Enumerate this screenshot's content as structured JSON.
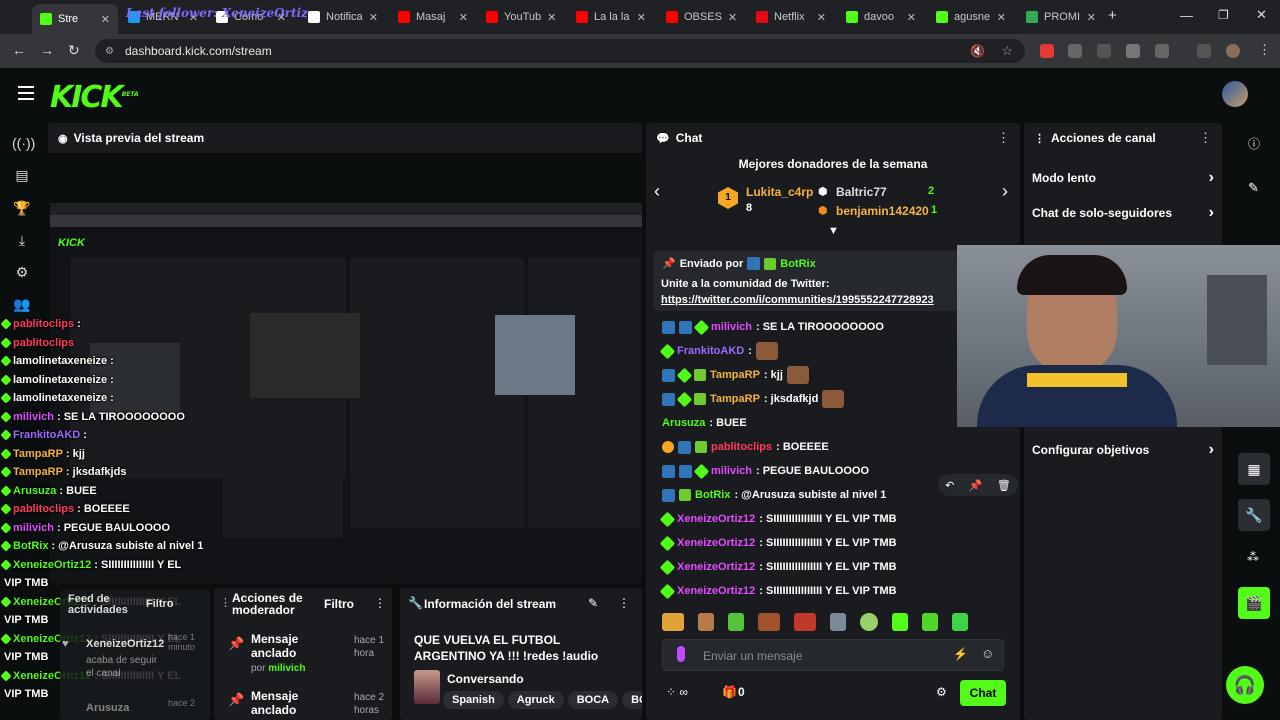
{
  "browser": {
    "tabs": [
      {
        "label": "Stre",
        "active": true,
        "color": "#53fc18"
      },
      {
        "label": "MERN",
        "color": "#1d9bf0"
      },
      {
        "label": "Como",
        "color": "#ffffff"
      },
      {
        "label": "Notifica",
        "color": "#ffffff"
      },
      {
        "label": "Masaj",
        "color": "#ff0000"
      },
      {
        "label": "YouTub",
        "color": "#ff0000"
      },
      {
        "label": "La la la",
        "color": "#ff0000"
      },
      {
        "label": "OBSES",
        "color": "#ff0000"
      },
      {
        "label": "Netflix",
        "color": "#e50914"
      },
      {
        "label": "davoo",
        "color": "#53fc18"
      },
      {
        "label": "agusne",
        "color": "#53fc18"
      },
      {
        "label": "PROMI",
        "color": "#34a853"
      }
    ],
    "overlay_text": "Last follower: XeneizeOrtiz",
    "url": "dashboard.kick.com/stream"
  },
  "kick": {
    "logo": "KICK",
    "logo_beta": "BETA"
  },
  "preview": {
    "title": "Vista previa del stream"
  },
  "chat": {
    "title": "Chat",
    "donors_title": "Mejores donadores de la semana",
    "donors": [
      {
        "name": "Lukita_c4rp",
        "count": "8",
        "rank": "1"
      },
      {
        "name": "Baltric77",
        "count": "2"
      },
      {
        "name": "benjamin142420",
        "count": "1"
      }
    ],
    "pinned": {
      "sent_by_label": "Enviado por",
      "sent_by": "BotRix",
      "text": "Unite a la comunidad de Twitter:",
      "link": "https://twitter.com/i/communities/1995552247728923"
    },
    "messages": [
      {
        "user": "milivich",
        "color": "#e24cff",
        "text": ": SE LA TIROOOOOOOO",
        "badges": [
          "blue",
          "blue",
          "green"
        ]
      },
      {
        "user": "FrankitoAKD",
        "color": "#9b6bff",
        "text": ":",
        "badges": [
          "green"
        ]
      },
      {
        "user": "TampaRP",
        "color": "#f5b342",
        "text": ": kjj",
        "badges": [
          "blue",
          "green",
          "gift"
        ]
      },
      {
        "user": "TampaRP",
        "color": "#f5b342",
        "text": ": jksdafkjd",
        "badges": [
          "blue",
          "green",
          "gift"
        ]
      },
      {
        "user": "Arusuza",
        "color": "#53fc18",
        "text": ": BUEE",
        "badges": []
      },
      {
        "user": "pablitoclips",
        "color": "#ff3b5c",
        "text": ": BOEEEE",
        "badges": [
          "crown",
          "blue",
          "gift"
        ]
      },
      {
        "user": "milivich",
        "color": "#e24cff",
        "text": ": PEGUE BAULOOOO",
        "badges": [
          "blue",
          "blue",
          "green"
        ]
      },
      {
        "user": "BotRix",
        "color": "#53fc18",
        "text": ": @Arusuza subiste al nivel 1",
        "badges": [
          "blue",
          "gift"
        ]
      },
      {
        "user": "XeneizeOrtiz12",
        "color": "#e24cff",
        "text": ": SIIIIIIIIIIIIIIII Y EL VIP TMB",
        "badges": [
          "green"
        ]
      },
      {
        "user": "XeneizeOrtiz12",
        "color": "#e24cff",
        "text": ": SIIIIIIIIIIIIIIII Y EL VIP TMB",
        "badges": [
          "green"
        ]
      },
      {
        "user": "XeneizeOrtiz12",
        "color": "#e24cff",
        "text": ": SIIIIIIIIIIIIIIII Y EL VIP TMB",
        "badges": [
          "green"
        ]
      },
      {
        "user": "XeneizeOrtiz12",
        "color": "#e24cff",
        "text": ": SIIIIIIIIIIIIIIII Y EL VIP TMB",
        "badges": [
          "green"
        ]
      }
    ],
    "input_placeholder": "Enviar un mensaje",
    "viewers_count": "0",
    "send_label": "Chat"
  },
  "actions": {
    "title": "Acciones de canal",
    "items": [
      {
        "label": "Modo lento"
      },
      {
        "label": "Chat de solo-seguidores"
      },
      {
        "label": "Configurar objetivos"
      }
    ]
  },
  "activity": {
    "title": "Feed de actividades",
    "filter": "Filtro",
    "user": "XeneizeOrtiz12",
    "time": "hace 1 minuto",
    "text": "acaba de seguir el canal",
    "next_user": "Arusuza",
    "next_time": "hace 2"
  },
  "modactions": {
    "title": "Acciones de moderador",
    "filter": "Filtro",
    "items": [
      {
        "label": "Mensaje anclado",
        "by_label": "por",
        "by": "milivich",
        "time": "hace 1 hora"
      },
      {
        "label": "Mensaje anclado",
        "time": "hace 2 horas"
      }
    ]
  },
  "streaminfo": {
    "title": "Información del stream",
    "stream_title": "QUE VUELVA EL FUTBOL ARGENTINO YA !!! !redes !audio",
    "category": "Conversando",
    "tags": [
      "Spanish",
      "Agruck",
      "BOCA",
      "BOC"
    ]
  },
  "overlay_chat": [
    {
      "user": "pablitoclips",
      "color": "#ff3b5c",
      "text": ":"
    },
    {
      "user": "pablitoclips",
      "color": "#ff3b5c",
      "text": ""
    },
    {
      "user": "lamolinetaxeneize",
      "color": "#ffffff",
      "text": ":"
    },
    {
      "user": "lamolinetaxeneize",
      "color": "#ffffff",
      "text": ":"
    },
    {
      "user": "lamolinetaxeneize",
      "color": "#ffffff",
      "text": ":"
    },
    {
      "user": "milivich",
      "color": "#e24cff",
      "text": ": SE LA TIROOOOOOOO"
    },
    {
      "user": "FrankitoAKD",
      "color": "#9b6bff",
      "text": ":"
    },
    {
      "user": "TampaRP",
      "color": "#f5b342",
      "text": ": kjj"
    },
    {
      "user": "TampaRP",
      "color": "#f5b342",
      "text": ": jksdafkjds"
    },
    {
      "user": "Arusuza",
      "color": "#53fc18",
      "text": ": BUEE"
    },
    {
      "user": "pablitoclips",
      "color": "#ff3b5c",
      "text": ": BOEEEE"
    },
    {
      "user": "milivich",
      "color": "#e24cff",
      "text": ": PEGUE BAULOOOO"
    },
    {
      "user": "BotRix",
      "color": "#53fc18",
      "text": ": @Arusuza subiste al nivel 1"
    },
    {
      "user": "XeneizeOrtiz12",
      "color": "#53fc18",
      "text": ": SIIIIIIIIIIIIIII Y EL"
    },
    {
      "user": "",
      "color": "#ffffff",
      "text": "VIP TMB"
    },
    {
      "user": "XeneizeOrtiz12",
      "color": "#53fc18",
      "text": ": SIIIIIIIIIIIIIII Y EL"
    },
    {
      "user": "",
      "color": "#ffffff",
      "text": "VIP TMB"
    },
    {
      "user": "XeneizeOrtiz12",
      "color": "#53fc18",
      "text": ": SIIIIIIIIIIIIIII Y EL"
    },
    {
      "user": "",
      "color": "#ffffff",
      "text": "VIP TMB"
    },
    {
      "user": "XeneizeOrtiz12",
      "color": "#53fc18",
      "text": ": SIIIIIIIIIIIIIII Y EL"
    },
    {
      "user": "",
      "color": "#ffffff",
      "text": "VIP TMB"
    }
  ]
}
